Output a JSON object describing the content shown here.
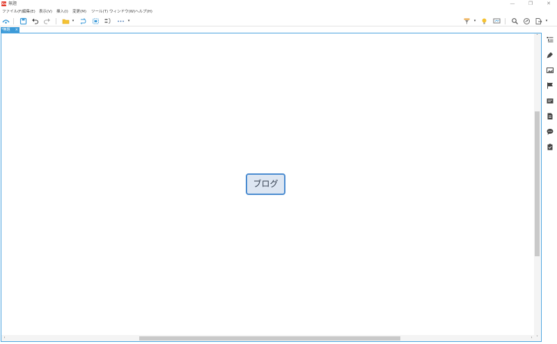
{
  "window": {
    "app_logo": "Xm",
    "title": "無題",
    "minimize": "—",
    "restore": "❐",
    "close": "✕"
  },
  "menu": {
    "items": [
      {
        "label": "ファイル(F)"
      },
      {
        "label": "編集(E)"
      },
      {
        "label": "表示(V)"
      },
      {
        "label": "挿入(I)"
      },
      {
        "label": "変更(M)"
      },
      {
        "label": "ツール(T)"
      },
      {
        "label": "ウィンドウ(W)"
      },
      {
        "label": "ヘルプ(H)"
      }
    ]
  },
  "toolbar": {
    "left_icons": [
      "home-icon",
      "save-icon",
      "undo-icon",
      "redo-icon",
      "folder-icon",
      "relationship-icon",
      "boundary-icon",
      "summary-icon",
      "more-icon"
    ],
    "right_icons": [
      "filter-icon",
      "lightbulb-icon",
      "presentation-icon",
      "search-icon",
      "share-icon",
      "export-icon"
    ],
    "caret": "▾"
  },
  "tabs": [
    {
      "label": "*無題",
      "close": "×"
    }
  ],
  "canvas": {
    "central_topic": "ブログ"
  },
  "scrollbars": {
    "up": "˄",
    "down": "˅",
    "left": "‹",
    "right": "›"
  },
  "side_panel": {
    "icons": [
      "outline-icon",
      "format-icon",
      "image-icon",
      "marker-icon",
      "notes-icon",
      "document-icon",
      "comment-icon",
      "task-icon"
    ]
  },
  "colors": {
    "accent": "#3d9bd8",
    "topic_fill": "#dde6f2",
    "topic_border": "#4a8bd0",
    "logo": "#e23a2c"
  }
}
